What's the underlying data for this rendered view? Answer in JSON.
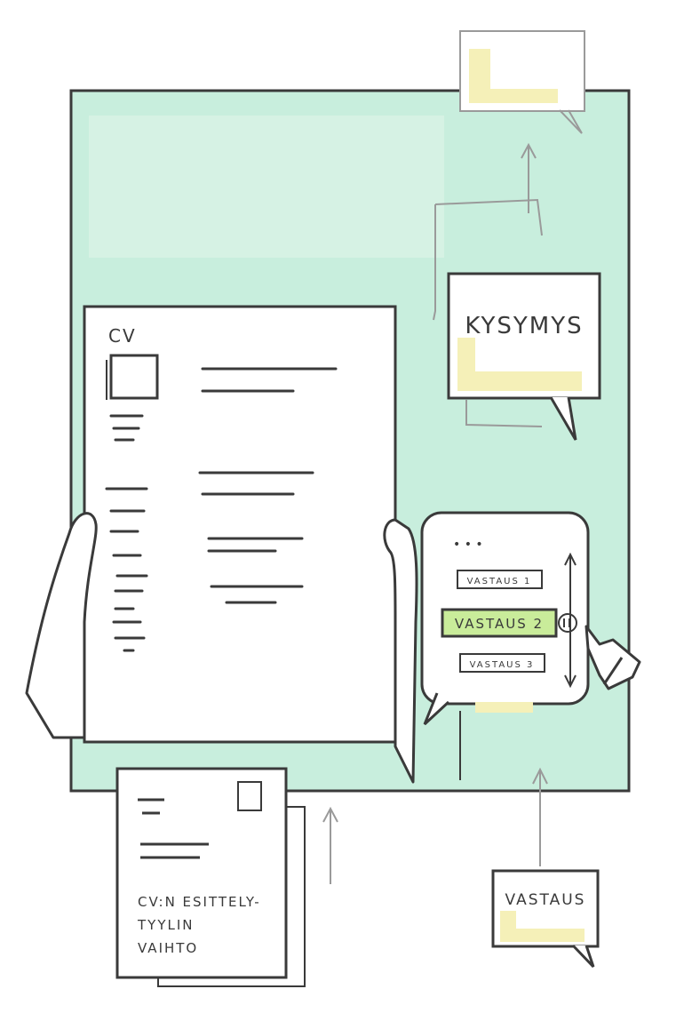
{
  "colors": {
    "screen_bg": "#c8eedd",
    "screen_bg_light": "#dff5ea",
    "stroke": "#3a3a3a",
    "stroke_light": "#9a9a9a",
    "highlight_yellow": "#f5f0b8",
    "selected_green": "#c9ec9a",
    "paper": "#ffffff"
  },
  "cv": {
    "label": "CV"
  },
  "question_bubble": {
    "label": "KYSYMYS"
  },
  "answer_selector": {
    "typing_dots": "• • •",
    "options": [
      "VASTAUS 1",
      "VASTAUS 2",
      "VASTAUS 3"
    ],
    "selected_index": 1,
    "confirm_icon": "arrow-right-icon"
  },
  "style_switch_card": {
    "lines": [
      "CV:N ESITTELY-",
      "TYYLIN",
      "VAIHTO"
    ]
  },
  "answer_bubble": {
    "label": "VASTAUS"
  },
  "icons": {
    "hand": "hand-icon",
    "pointer_hand": "pointing-hand-icon",
    "arrow": "arrow-up-icon"
  }
}
